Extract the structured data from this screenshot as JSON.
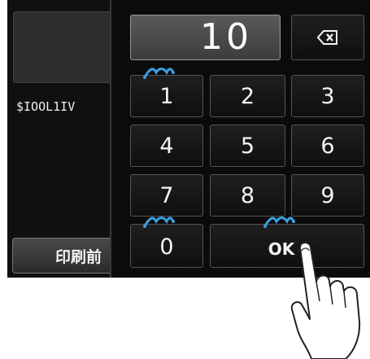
{
  "background": {
    "ssid_text": "$IOOL1IV",
    "print_button_label": "印刷前"
  },
  "keypad": {
    "value": "10",
    "backspace_icon": "backspace-icon",
    "keys": [
      "1",
      "2",
      "3",
      "4",
      "5",
      "6",
      "7",
      "8",
      "9",
      "0"
    ],
    "ok_label": "OK",
    "hint_icon": "sparkle-hint-icon"
  },
  "colors": {
    "screen_bg": "#101010",
    "key_border": "#555555",
    "hint_blue": "#3aa0e0"
  }
}
